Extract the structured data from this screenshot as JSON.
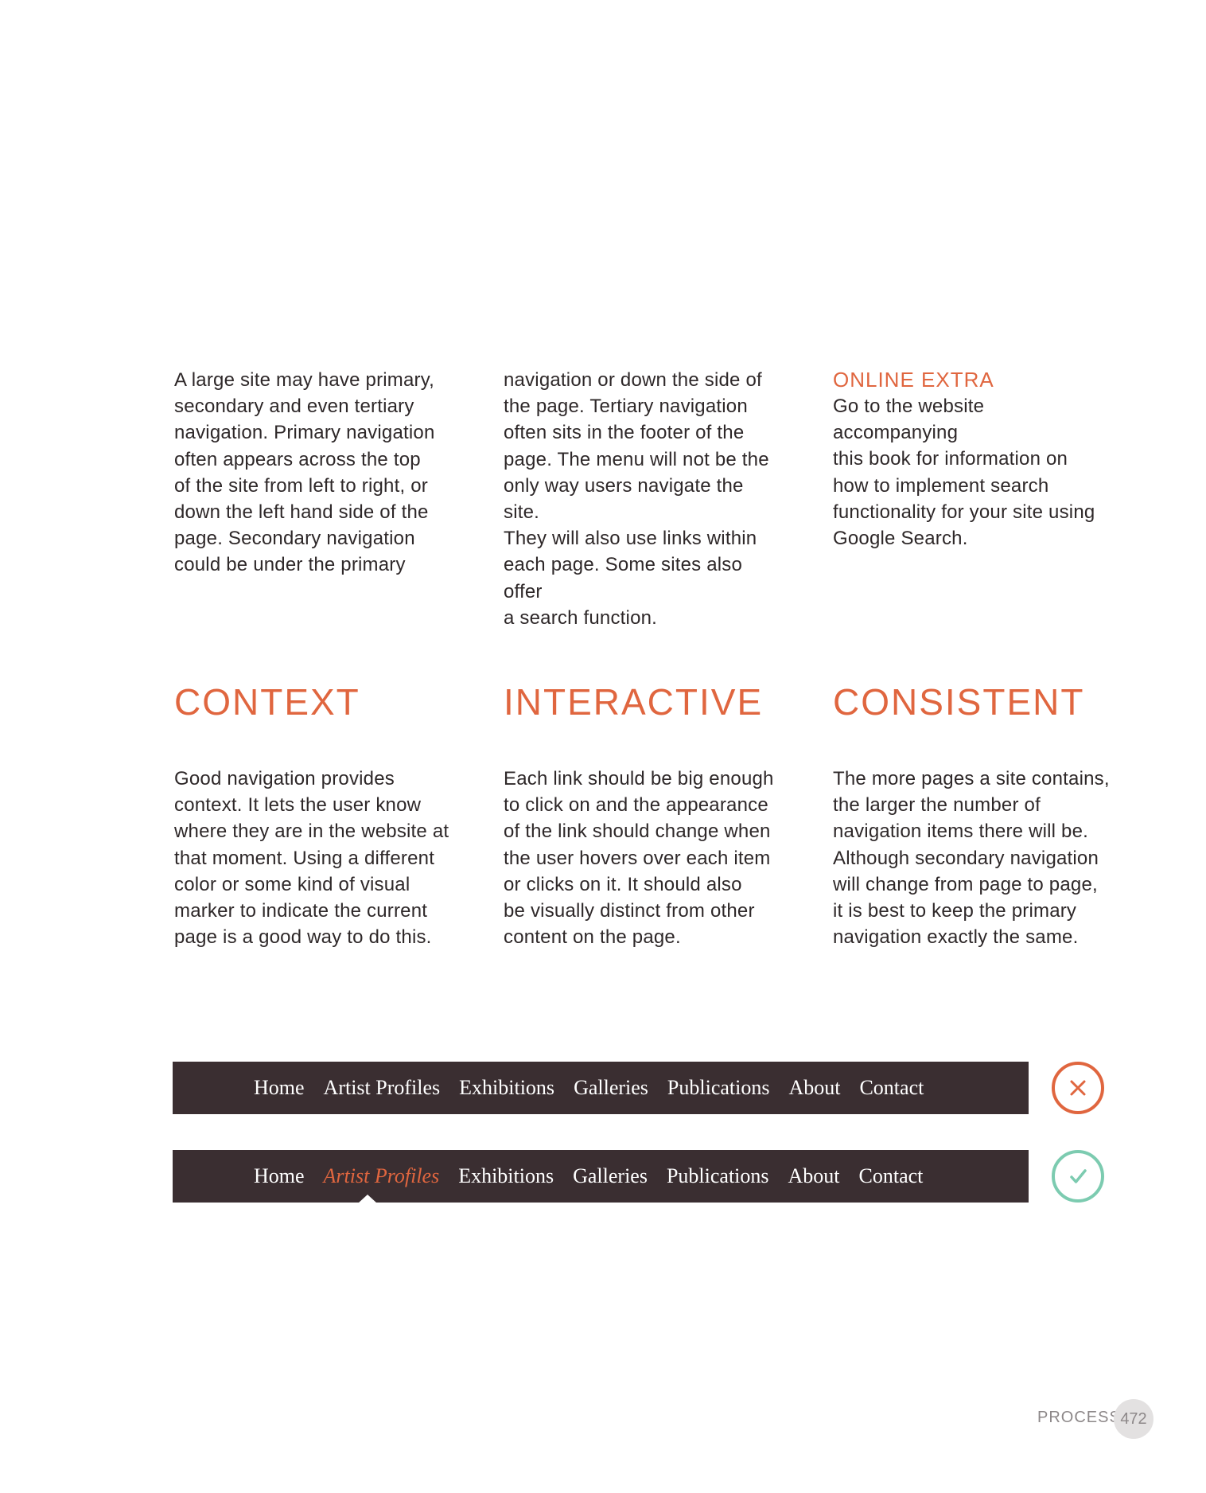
{
  "intro": {
    "col1": "A large site may have primary,\nsecondary and even tertiary\nnavigation. Primary navigation\noften appears across the top\nof the site from left to right, or\ndown the left hand side of the\npage. Secondary navigation\ncould be under the primary",
    "col2": "navigation or down the side of\nthe page. Tertiary navigation\noften sits in the footer of the\npage. The menu will not be the\nonly way users navigate the site.\nThey will also use links within\neach page. Some sites also offer\na search function.",
    "online_extra": {
      "heading": "ONLINE EXTRA",
      "text": "Go to the website accompanying\nthis book for information on\nhow to implement search\nfunctionality for your site using\nGoogle Search."
    }
  },
  "sections": [
    {
      "heading": "CONTEXT",
      "text": "Good navigation provides\ncontext. It lets the user know\nwhere they are in the website at\nthat moment. Using a different\ncolor or some kind of visual\nmarker to indicate the current\npage is a good way to do this."
    },
    {
      "heading": "INTERACTIVE",
      "text": "Each link should be big enough\nto click on and the appearance\nof the link should change when\nthe user hovers over each item\nor clicks on it. It should also\nbe visually distinct from other\ncontent on the page."
    },
    {
      "heading": "CONSISTENT",
      "text": "The more pages a site contains,\nthe larger the number of\nnavigation items there will be.\nAlthough secondary navigation\nwill change from page to page,\nit is best to keep the primary\nnavigation exactly the same."
    }
  ],
  "nav_examples": [
    {
      "items": [
        "Home",
        "Artist Profiles",
        "Exhibitions",
        "Galleries",
        "Publications",
        "About",
        "Contact"
      ],
      "active_index": null,
      "badge_icon": "cross-icon",
      "badge_color": "#e0663f"
    },
    {
      "items": [
        "Home",
        "Artist Profiles",
        "Exhibitions",
        "Galleries",
        "Publications",
        "About",
        "Contact"
      ],
      "active_index": 1,
      "badge_icon": "check-icon",
      "badge_color": "#7ccbb0"
    }
  ],
  "colors": {
    "accent": "#e0663f",
    "navbar": "#3a2e31",
    "success": "#7ccbb0"
  },
  "footer": {
    "section_label": "PROCESS",
    "page_number": "472"
  }
}
